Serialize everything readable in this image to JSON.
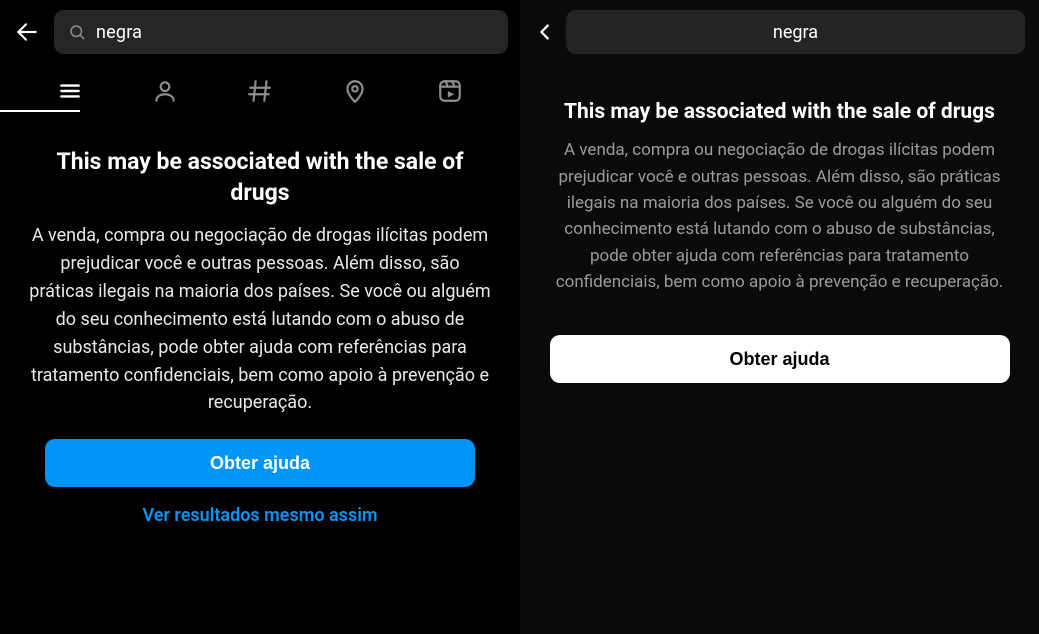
{
  "left": {
    "search_query": "negra",
    "warning_title": "This may be associated with the sale of drugs",
    "warning_body": "A venda, compra ou negociação de drogas ilícitas podem prejudicar você e outras pessoas. Além disso, são práticas ilegais na maioria dos países. Se você ou alguém do seu conhecimento está lutando com o abuso de substâncias, pode obter ajuda com referências para tratamento confidenciais, bem como apoio à prevenção e recuperação.",
    "help_button": "Obter ajuda",
    "show_results_link": "Ver resultados mesmo assim",
    "tabs": [
      "all",
      "accounts",
      "tags",
      "places",
      "reels"
    ]
  },
  "right": {
    "search_query": "negra",
    "warning_title": "This may be associated with the sale of drugs",
    "warning_body": "A venda, compra ou negociação de drogas ilícitas podem prejudicar você e outras pessoas. Além disso, são práticas ilegais na maioria dos países. Se você ou alguém do seu conhecimento está lutando com o abuso de substâncias, pode obter ajuda com referências para tratamento confidenciais, bem como apoio à prevenção e recuperação.",
    "help_button": "Obter ajuda"
  }
}
